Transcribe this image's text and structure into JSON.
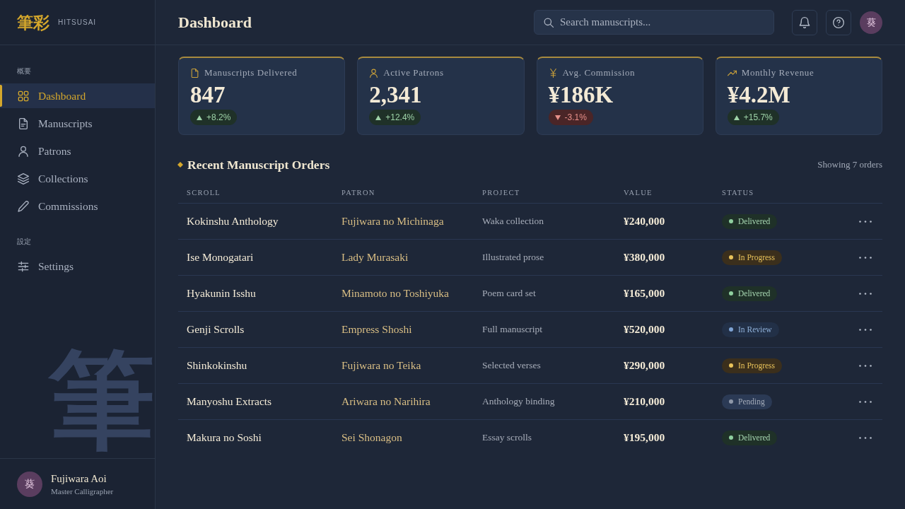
{
  "sidebar": {
    "logo": {
      "mark": "筆彩",
      "name": "HITSUSAI"
    },
    "sections": [
      {
        "label": "概要",
        "items": [
          {
            "label": "Dashboard",
            "selected": true
          },
          {
            "label": "Manuscripts",
            "selected": false
          },
          {
            "label": "Patrons",
            "selected": false
          },
          {
            "label": "Collections",
            "selected": false
          },
          {
            "label": "Commissions",
            "selected": false
          }
        ]
      },
      {
        "label": "設定",
        "items": [
          {
            "label": "Settings",
            "selected": false
          }
        ]
      }
    ],
    "watermark": "筆",
    "user": {
      "avatar": "葵",
      "name": "Fujiwara Aoi",
      "role": "Master Calligrapher"
    }
  },
  "header": {
    "title": "Dashboard",
    "search": {
      "placeholder": "Search manuscripts..."
    },
    "avatar": "葵"
  },
  "stats": [
    {
      "label": "Manuscripts Delivered",
      "value": "847",
      "change": "+8.2%",
      "rising": true
    },
    {
      "label": "Active Patrons",
      "value": "2,341",
      "change": "+12.4%",
      "rising": true
    },
    {
      "label": "Avg. Commission",
      "value": "¥186K",
      "change": "-3.1%",
      "rising": false
    },
    {
      "label": "Monthly Revenue",
      "value": "¥4.2M",
      "change": "+15.7%",
      "rising": true
    }
  ],
  "orders": {
    "title": "Recent Manuscript Orders",
    "count": "Showing 7 orders",
    "columns": [
      "SCROLL",
      "PATRON",
      "PROJECT",
      "VALUE",
      "STATUS"
    ],
    "rows": [
      {
        "scroll": "Kokinshu Anthology",
        "patron": "Fujiwara no Michinaga",
        "project": "Waka collection",
        "value": "¥240,000",
        "status": {
          "label": "Delivered",
          "kind": "delivered"
        }
      },
      {
        "scroll": "Ise Monogatari",
        "patron": "Lady Murasaki",
        "project": "Illustrated prose",
        "value": "¥380,000",
        "status": {
          "label": "In Progress",
          "kind": "progress"
        }
      },
      {
        "scroll": "Hyakunin Isshu",
        "patron": "Minamoto no Toshiyuka",
        "project": "Poem card set",
        "value": "¥165,000",
        "status": {
          "label": "Delivered",
          "kind": "delivered"
        }
      },
      {
        "scroll": "Genji Scrolls",
        "patron": "Empress Shoshi",
        "project": "Full manuscript",
        "value": "¥520,000",
        "status": {
          "label": "In Review",
          "kind": "review"
        }
      },
      {
        "scroll": "Shinkokinshu",
        "patron": "Fujiwara no Teika",
        "project": "Selected verses",
        "value": "¥290,000",
        "status": {
          "label": "In Progress",
          "kind": "progress"
        }
      },
      {
        "scroll": "Manyoshu Extracts",
        "patron": "Ariwara no Narihira",
        "project": "Anthology binding",
        "value": "¥210,000",
        "status": {
          "label": "Pending",
          "kind": "pending"
        }
      },
      {
        "scroll": "Makura no Soshi",
        "patron": "Sei Shonagon",
        "project": "Essay scrolls",
        "value": "¥195,000",
        "status": {
          "label": "Delivered",
          "kind": "delivered"
        }
      }
    ]
  }
}
